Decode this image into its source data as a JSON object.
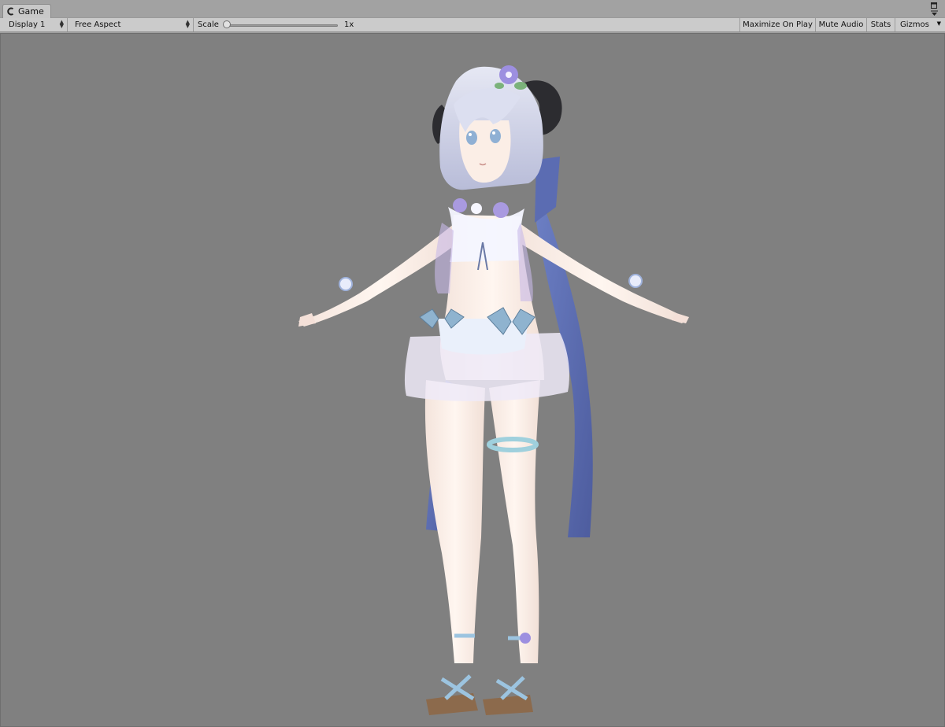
{
  "tab": {
    "label": "Game",
    "icon": "unity-game-icon"
  },
  "window_controls": {
    "maximize_icon": "maximize-icon",
    "menu_icon": "window-menu-icon"
  },
  "toolbar": {
    "display": {
      "value": "Display 1"
    },
    "aspect": {
      "value": "Free Aspect"
    },
    "scale": {
      "label": "Scale",
      "value": "1x",
      "level": 0.0
    },
    "maximize_on_play": "Maximize On Play",
    "mute_audio": "Mute Audio",
    "stats": "Stats",
    "gizmos": "Gizmos"
  },
  "viewport": {
    "background": "#808080",
    "content": "3d-character-t-pose"
  },
  "colors": {
    "editor_bg": "#a2a2a2",
    "toolbar_bg": "#cbcbcb",
    "skin": "#fbeee6",
    "hair": "#d4d6ea",
    "ribbon": "#5e6fb4",
    "accent": "#8fb3cf"
  }
}
